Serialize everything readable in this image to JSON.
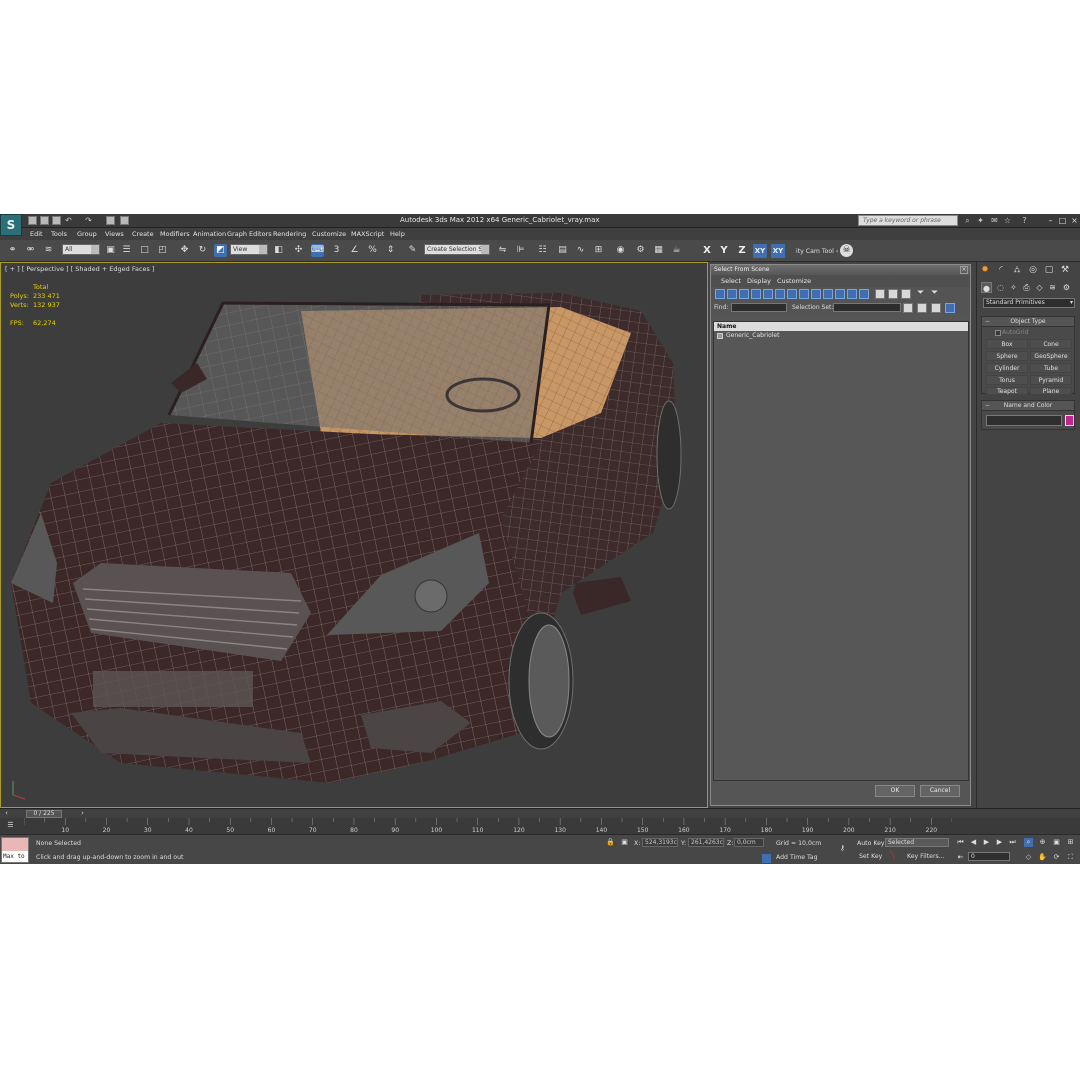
{
  "titlebar": {
    "title": "Autodesk 3ds Max  2012 x64     Generic_Cabriolet_vray.max",
    "search_placeholder": "Type a keyword or phrase"
  },
  "menus": [
    "Edit",
    "Tools",
    "Group",
    "Views",
    "Create",
    "Modifiers",
    "Animation",
    "Graph Editors",
    "Rendering",
    "Customize",
    "MAXScript",
    "Help"
  ],
  "toolbar": {
    "filter_value": "All",
    "refcoord_value": "View",
    "selection_set_value": "Create Selection Se",
    "axes": [
      "X",
      "Y",
      "Z"
    ],
    "plane_axes": [
      "XY",
      "XY"
    ],
    "cam_tool_label": "ity Cam Tool ‹"
  },
  "viewport": {
    "label": "[ + ] [ Perspective ] [ Shaded + Edged Faces ]",
    "stats": {
      "total_label": "Total",
      "polys_label": "Polys:",
      "polys_value": "233 471",
      "verts_label": "Verts:",
      "verts_value": "132 937",
      "fps_label": "FPS:",
      "fps_value": "62,274"
    }
  },
  "dialog": {
    "title": "Select From Scene",
    "menus": [
      "Select",
      "Display",
      "Customize"
    ],
    "find_label": "Find:",
    "selection_set_label": "Selection Set:",
    "list_header": "Name",
    "items": [
      "Generic_Cabriolet"
    ],
    "ok_label": "OK",
    "cancel_label": "Cancel"
  },
  "command_panel": {
    "dropdown_value": "Standard Primitives",
    "object_type_title": "Object Type",
    "autogrid_label": "AutoGrid",
    "primitives": [
      "Box",
      "Cone",
      "Sphere",
      "GeoSphere",
      "Cylinder",
      "Tube",
      "Torus",
      "Pyramid",
      "Teapot",
      "Plane"
    ],
    "name_color_title": "Name and Color",
    "object_color": "#c2258b"
  },
  "timeline": {
    "slider_label": "0 / 225",
    "ticks": [
      "10",
      "20",
      "30",
      "40",
      "50",
      "60",
      "70",
      "80",
      "90",
      "100",
      "110",
      "120",
      "130",
      "140",
      "150",
      "160",
      "170",
      "180",
      "190",
      "200",
      "210",
      "220"
    ]
  },
  "statusbar": {
    "maxscript_text": "Max to",
    "selection_status": "None Selected",
    "prompt": "Click and drag up-and-down to zoom in and out",
    "x_label": "X:",
    "x_value": "524,3193c",
    "y_label": "Y:",
    "y_value": "261,4263c",
    "z_label": "Z:",
    "z_value": "0,0cm",
    "grid": "Grid = 10,0cm",
    "add_time_tag": "Add Time Tag",
    "auto_key": "Auto Key",
    "set_key": "Set Key",
    "key_mode_value": "Selected",
    "key_filters": "Key Filters...",
    "frame_value": "0"
  }
}
